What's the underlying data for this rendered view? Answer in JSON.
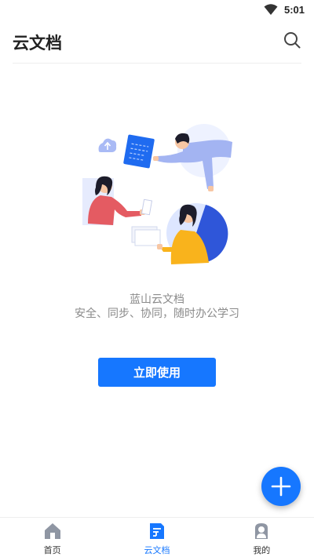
{
  "status_bar": {
    "time": "5:01",
    "icons": [
      "wifi-icon"
    ]
  },
  "header": {
    "title": "云文档",
    "search_icon": "search-icon"
  },
  "empty_state": {
    "illustration": "collaboration-illustration",
    "title": "蓝山云文档",
    "subtitle": "安全、同步、协同，随时办公学习",
    "button_label": "立即使用"
  },
  "fab": {
    "icon": "plus-icon"
  },
  "bottom_nav": {
    "tabs": [
      {
        "label": "首页",
        "icon": "home-icon",
        "active": false
      },
      {
        "label": "云文档",
        "icon": "cloud-document-icon",
        "active": true
      },
      {
        "label": "我的",
        "icon": "profile-icon",
        "active": false
      }
    ]
  },
  "colors": {
    "accent": "#1677ff",
    "muted_text": "#8a8a8a",
    "divider": "#eeeeee"
  }
}
